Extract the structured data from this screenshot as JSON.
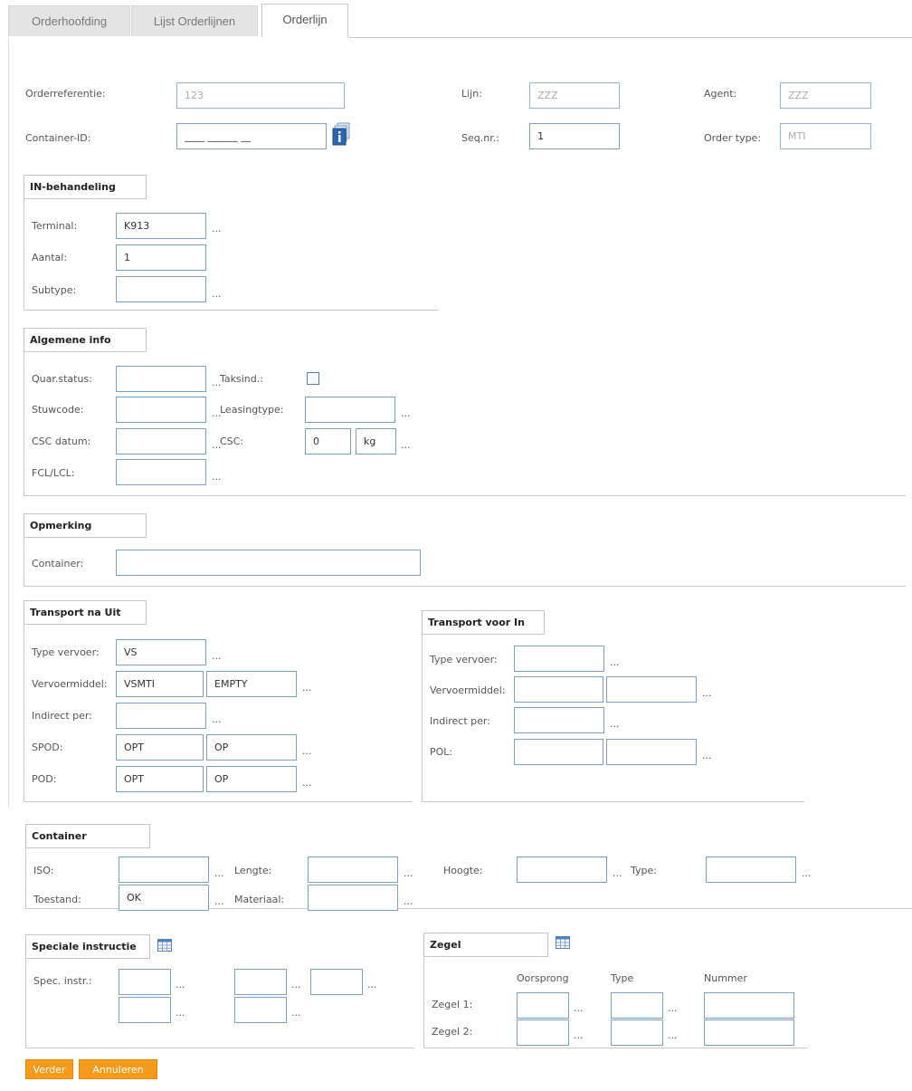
{
  "tabs": [
    "Orderhoofding",
    "Lijst Orderlijnen",
    "Orderlijn"
  ],
  "header": {
    "orderref_label": "Orderreferentie:",
    "orderref_value": "123",
    "lijn_label": "Lijn:",
    "lijn_value": "ZZZ",
    "agent_label": "Agent:",
    "agent_value": "ZZZ",
    "container_id_label": "Container-ID:",
    "container_id_value": "____ ______ __",
    "seqnr_label": "Seq.nr.:",
    "seqnr_value": "1",
    "ordertype_label": "Order type:",
    "ordertype_value": "MTI"
  },
  "in_behandeling": {
    "title": "IN-behandeling",
    "terminal_label": "Terminal:",
    "terminal_value": "K913",
    "aantal_label": "Aantal:",
    "aantal_value": "1",
    "subtype_label": "Subtype:",
    "subtype_value": ""
  },
  "algemene_info": {
    "title": "Algemene info",
    "quar_label": "Quar.status:",
    "taksind_label": "Taksind.:",
    "stuwcode_label": "Stuwcode:",
    "leasingtype_label": "Leasingtype:",
    "csc_datum_label": "CSC datum:",
    "csc_label": "CSC:",
    "csc_value": "0",
    "csc_unit": "kg",
    "fcl_label": "FCL/LCL:"
  },
  "opmerking": {
    "title": "Opmerking",
    "container_label": "Container:",
    "container_value": ""
  },
  "transport_na_uit": {
    "title": "Transport na Uit",
    "type_label": "Type vervoer:",
    "type_value": "VS",
    "vervoermiddel_label": "Vervoermiddel:",
    "vervoermiddel_value1": "VSMTI",
    "vervoermiddel_value2": "EMPTY",
    "indirect_label": "Indirect per:",
    "spod_label": "SPOD:",
    "spod_value1": "OPT",
    "spod_value2": "OP",
    "pod_label": "POD:",
    "pod_value1": "OPT",
    "pod_value2": "OP"
  },
  "transport_voor_in": {
    "title": "Transport voor In",
    "type_label": "Type vervoer:",
    "vervoermiddel_label": "Vervoermiddel:",
    "indirect_label": "Indirect per:",
    "pol_label": "POL:"
  },
  "container": {
    "title": "Container",
    "iso_label": "ISO:",
    "lengte_label": "Lengte:",
    "hoogte_label": "Hoogte:",
    "type_label": "Type:",
    "toestand_label": "Toestand:",
    "toestand_value": "OK",
    "materiaal_label": "Materiaal:"
  },
  "speciale_instructie": {
    "title": "Speciale instructie",
    "spec_label": "Spec. instr.:"
  },
  "zegel": {
    "title": "Zegel",
    "col_oorsprong": "Oorsprong",
    "col_type": "Type",
    "col_nummer": "Nummer",
    "zegel1_label": "Zegel 1:",
    "zegel2_label": "Zegel 2:"
  },
  "buttons": {
    "verder": "Verder",
    "annuleren": "Annuleren"
  },
  "dots": "...",
  "colors": {
    "accent": "#f59a1b",
    "input_border": "#7b9ec4"
  }
}
